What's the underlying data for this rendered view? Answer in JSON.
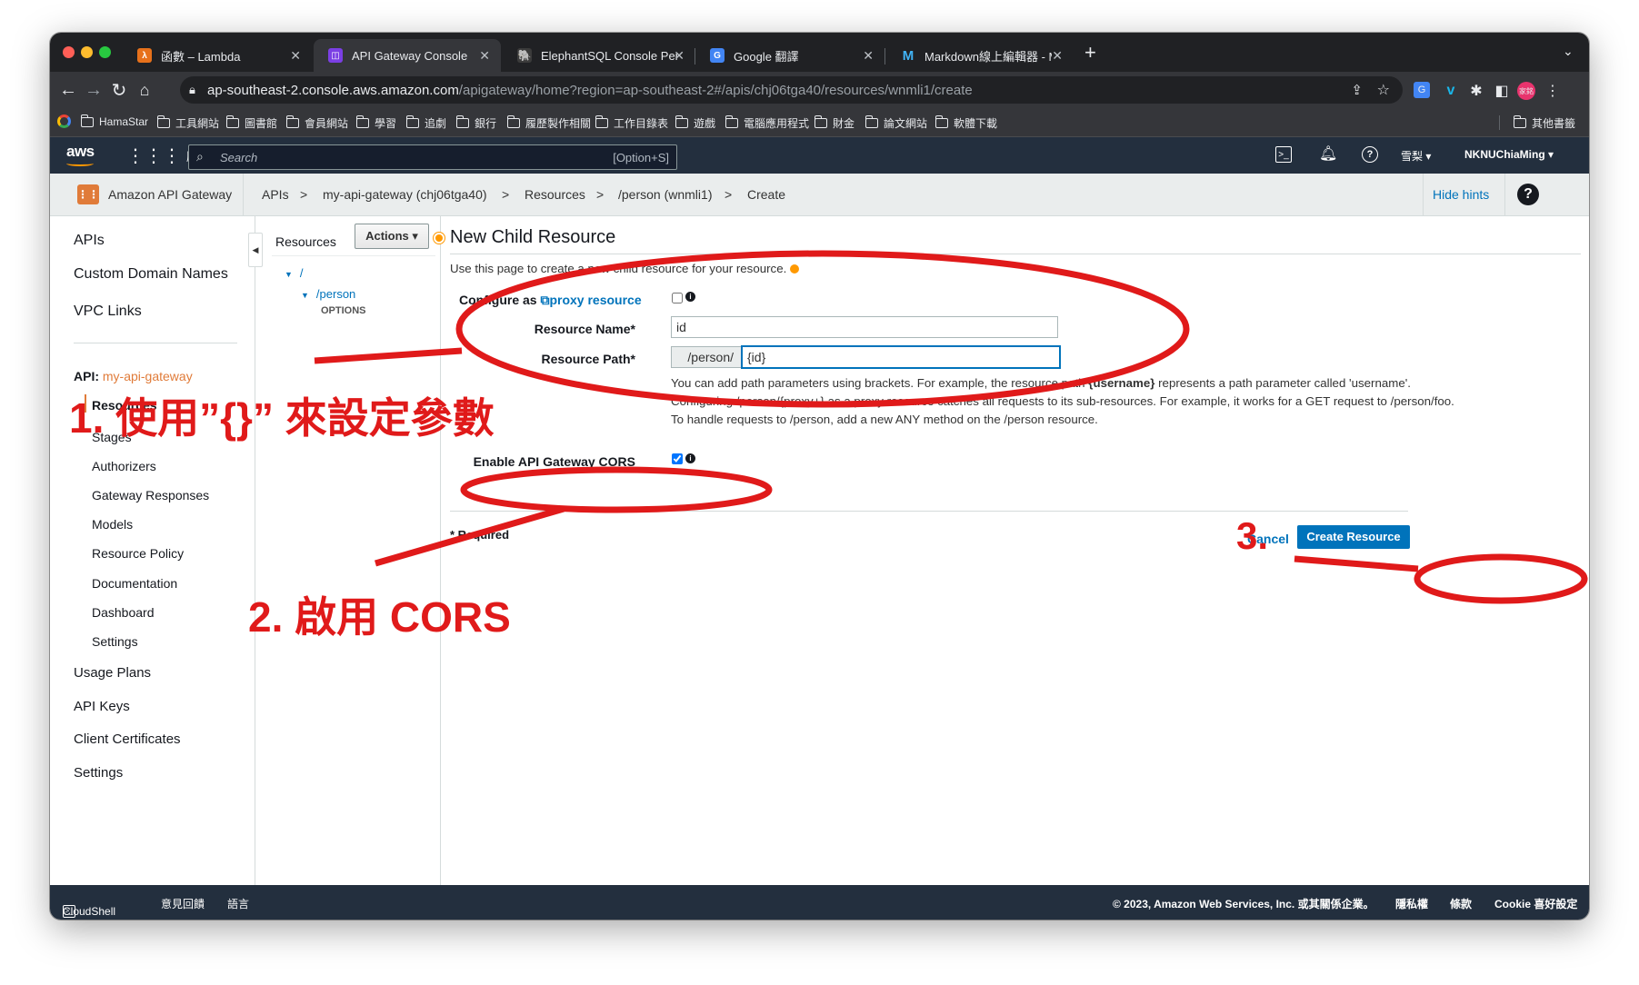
{
  "tabs": [
    {
      "title": "函數 – Lambda",
      "icon": "lambda-icon"
    },
    {
      "title": "API Gateway Console",
      "icon": "api-gateway-icon"
    },
    {
      "title": "ElephantSQL Console Personal",
      "icon": "elephant-icon"
    },
    {
      "title": "Google 翻譯",
      "icon": "google-translate-icon"
    },
    {
      "title": "Markdown線上編輯器 - MdEditor",
      "icon": "mdeditor-icon"
    }
  ],
  "url": {
    "host": "ap-southeast-2.console.aws.amazon.com",
    "path": "/apigateway/home?region=ap-southeast-2#/apis/chj06tga40/resources/wnmli1/create"
  },
  "bookmarks": [
    "HamaStar",
    "工具網站",
    "圖書館",
    "會員網站",
    "學習",
    "追劇",
    "銀行",
    "履歷製作相關",
    "工作目錄表",
    "遊戲",
    "電腦應用程式",
    "財金",
    "論文網站",
    "軟體下載"
  ],
  "bookmarks_other": "其他書籤",
  "aws": {
    "logo": "aws",
    "services": "服務",
    "search_placeholder": "Search",
    "search_shortcut": "[Option+S]",
    "region": "雪梨",
    "account": "NKNUChiaMing"
  },
  "breadcrumb": {
    "service": "Amazon API Gateway",
    "items": [
      "APIs",
      ">",
      "my-api-gateway (chj06tga40)",
      ">",
      "Resources",
      ">",
      "/person (wnmli1)",
      ">",
      "Create"
    ],
    "hide_hints": "Hide hints"
  },
  "leftnav": {
    "top": [
      "APIs",
      "Custom Domain Names",
      "VPC Links"
    ],
    "api_label": "API:",
    "api_name": "my-api-gateway",
    "sub": [
      "Resources",
      "Stages",
      "Authorizers",
      "Gateway Responses",
      "Models",
      "Resource Policy",
      "Documentation",
      "Dashboard",
      "Settings"
    ],
    "bottom": [
      "Usage Plans",
      "API Keys",
      "Client Certificates",
      "Settings"
    ]
  },
  "resources": {
    "title": "Resources",
    "actions": "Actions",
    "tree": [
      {
        "path": "/"
      },
      {
        "path": "/person"
      },
      {
        "method": "OPTIONS"
      }
    ]
  },
  "form": {
    "title": "New Child Resource",
    "intro": "Use this page to create a new child resource for your resource.",
    "configure_as": "Configure as",
    "proxy_link": "proxy resource",
    "resource_name_label": "Resource Name*",
    "resource_name_value": "id",
    "resource_path_label": "Resource Path*",
    "resource_path_prefix": "/person/",
    "resource_path_value": "{id}",
    "help1a": "You can add path parameters using brackets. For example, the resource path ",
    "help1b": "{username}",
    "help1c": " represents a path parameter called 'username'.",
    "help2": "Configuring /person/{proxy+} as a proxy resource catches all requests to its sub-resources. For example, it works for a GET request to /person/foo.",
    "help3": "To handle requests to /person, add a new ANY method on the /person resource.",
    "cors_label": "Enable API Gateway CORS",
    "cors_checked": true,
    "proxy_checked": false,
    "required": "* Required",
    "cancel": "Cancel",
    "create": "Create Resource"
  },
  "annotations": {
    "a1": "1. 使用”{}” 來設定參數",
    "a2": "2. 啟用 CORS",
    "a3": "3."
  },
  "footer": {
    "cloudshell": "CloudShell",
    "feedback": "意見回饋",
    "language": "語言",
    "copyright": "© 2023, Amazon Web Services, Inc. 或其關係企業。",
    "privacy": "隱私權",
    "terms": "條款",
    "cookie": "Cookie 喜好設定"
  },
  "colors": {
    "aws_nav": "#232f3e",
    "primary": "#0073bb",
    "annotation": "#e01a1a"
  }
}
